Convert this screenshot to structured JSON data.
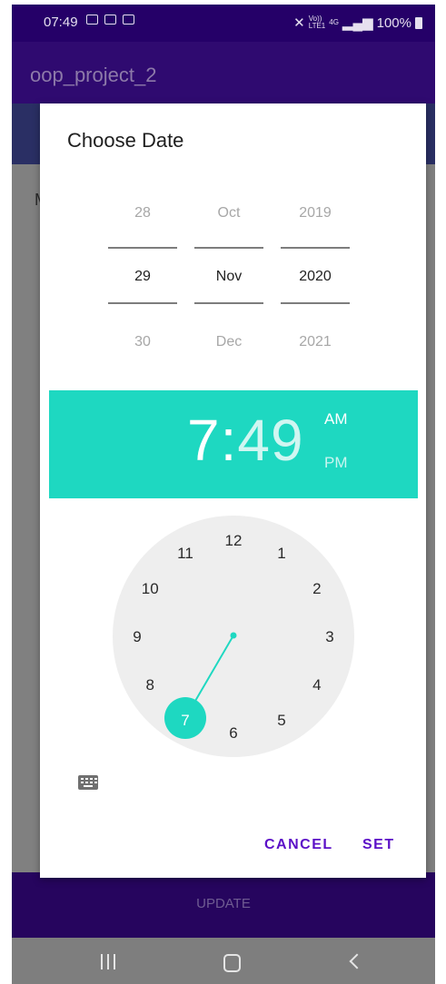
{
  "status_bar": {
    "time": "07:49",
    "network_label": "Vo))",
    "network_sub": "LTE1",
    "lte": "4G",
    "battery": "100%"
  },
  "app_bar": {
    "title": "oop_project_2"
  },
  "background": {
    "text_initial": "M",
    "update_label": "UPDATE"
  },
  "dialog": {
    "title": "Choose Date",
    "date_picker": {
      "days": [
        "28",
        "29",
        "30"
      ],
      "months": [
        "Oct",
        "Nov",
        "Dec"
      ],
      "years": [
        "2019",
        "2020",
        "2021"
      ]
    },
    "time_header": {
      "hour": "7",
      "colon": ":",
      "minute": "49",
      "am": "AM",
      "pm": "PM",
      "active_period": "AM"
    },
    "clock": {
      "numbers": [
        "12",
        "1",
        "2",
        "3",
        "4",
        "5",
        "6",
        "7",
        "8",
        "9",
        "10",
        "11"
      ],
      "selected": "7",
      "colors": {
        "face": "#eeeeee",
        "accent": "#1ed8c1"
      }
    },
    "buttons": {
      "cancel": "CANCEL",
      "set": "SET"
    }
  },
  "colors": {
    "primary_dark": "#250068",
    "primary": "#2f0a70",
    "accent": "#1ed8c1",
    "button_text": "#5b10c7"
  }
}
